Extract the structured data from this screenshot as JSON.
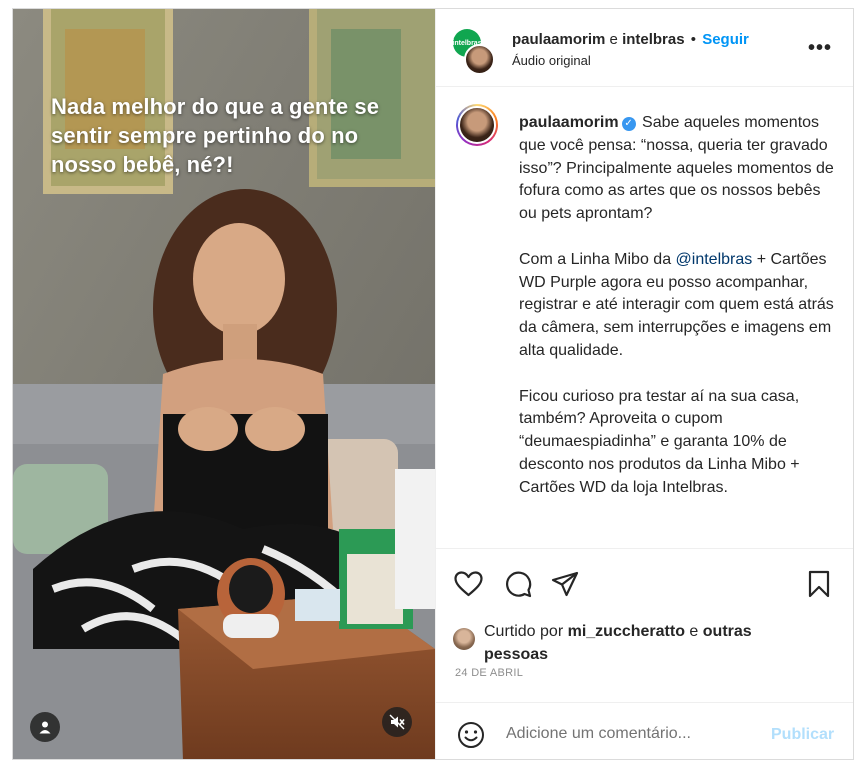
{
  "media": {
    "overlay_text": "Nada melhor do que a gente se sentir sempre pertinho do no nosso bebê, né?!",
    "user_tag_icon": "user-icon",
    "mute_icon": "speaker-muted-icon"
  },
  "header": {
    "username": "paulaamorim",
    "connector": "e",
    "collaborator": "intelbras",
    "separator": "•",
    "follow_label": "Seguir",
    "audio_label": "Áudio original",
    "collaborator_avatar_text": "intelbras",
    "more_label": "•••"
  },
  "caption": {
    "username": "paulaamorim",
    "verified_icon": "verified-badge-icon",
    "paragraph1": "Sabe aqueles momentos que você pensa: “nossa, queria ter gravado isso”? Principalmente aqueles momentos de fofura como as artes que os nossos bebês ou pets aprontam?",
    "paragraph2_before": "Com a Linha Mibo da ",
    "paragraph2_mention": "@intelbras",
    "paragraph2_after": " + Cartões WD Purple agora eu posso acompanhar, registrar e até interagir com quem está atrás da câmera, sem interrupções e imagens em alta qualidade.",
    "paragraph3": "Ficou curioso pra testar aí na sua casa, também? Aproveita o cupom “deumaespiadinha” e garanta 10% de desconto nos produtos da Linha Mibo + Cartões WD da loja Intelbras."
  },
  "actions": {
    "like_icon": "heart-icon",
    "comment_icon": "comment-icon",
    "share_icon": "paper-plane-icon",
    "save_icon": "bookmark-icon"
  },
  "likes": {
    "prefix": "Curtido por ",
    "user": "mi_zuccheratto",
    "connector": " e ",
    "others": "outras pessoas"
  },
  "date": "24 DE ABRIL",
  "comment": {
    "emoji_icon": "smiley-icon",
    "placeholder": "Adicione um comentário...",
    "publish_label": "Publicar"
  },
  "colors": {
    "follow": "#0095f6",
    "publish_disabled": "#b2dffc",
    "mention": "#00376b",
    "verified": "#3897f0"
  }
}
